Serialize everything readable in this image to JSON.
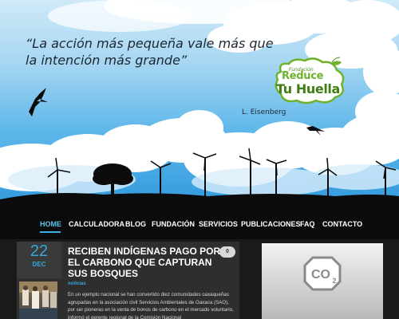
{
  "hero": {
    "quote": "“La acción más pequeña vale más que la intención más grande”",
    "author": "L. Eisenberg"
  },
  "logo": {
    "fundacion": "Fundación",
    "line1": "Reduce",
    "line2": "Tu Huella"
  },
  "nav": {
    "items": [
      {
        "label": "HOME",
        "active": true
      },
      {
        "label": "CALCULADORA"
      },
      {
        "label": "BLOG"
      },
      {
        "label": "FUNDACIÓN"
      },
      {
        "label": "SERVICIOS"
      },
      {
        "label": "PUBLICACIONES"
      },
      {
        "label": "FAQ"
      },
      {
        "label": "CONTACTO"
      }
    ]
  },
  "post": {
    "day": "22",
    "month": "DEC",
    "title": "RECIBEN INDÍGENAS PAGO POR EL CARBONO QUE CAPTURAN SUS BOSQUES",
    "comments": "0",
    "category": "noticias",
    "excerpt": "En un ejemplo nacional se han convertido diez comunidades oaxaqueñas agrupadas en la asociación civil Servicios Ambientales de Oaxaca (SAO), por ser pioneras en la venta de bonos de carbono en el mercado voluntario, informó el gerente regional de la Comisión Nacional"
  },
  "widget": {
    "badge": "CO2"
  },
  "colors": {
    "accent": "#35a8e0",
    "logo_green": "#6fb22c",
    "nav_bg": "#0b0b0b"
  }
}
